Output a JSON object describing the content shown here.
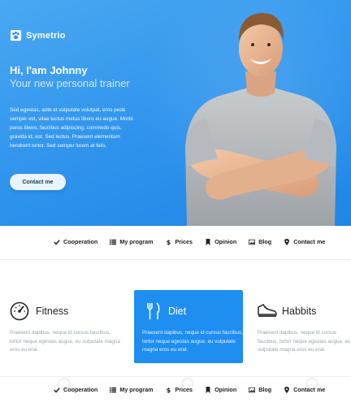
{
  "brand": {
    "name": "Symetrio"
  },
  "hero": {
    "title": "Hi, I'am Johnny",
    "subtitle": "Your new personal trainer",
    "text": "Sed egestas, ante et vulputate volutpat, eros pede semper est, vitae luctus metus libero eu augue. Morbi purus libero, faucibus adipiscing, commodo quis, gravida id, est. Sed lectus. Praesent elementum hendrerit tortor. Sed semper lorem at felis.",
    "button": "Contact me"
  },
  "nav": {
    "items": [
      {
        "label": "Cooperation",
        "icon": "check-icon"
      },
      {
        "label": "My program",
        "icon": "list-icon"
      },
      {
        "label": "Prices",
        "icon": "dollar-icon"
      },
      {
        "label": "Opinion",
        "icon": "bookmark-icon"
      },
      {
        "label": "Blog",
        "icon": "image-icon"
      },
      {
        "label": "Contact me",
        "icon": "map-marker-icon"
      }
    ]
  },
  "features": [
    {
      "title": "Fitness",
      "text": "Praesent dapibus, neque id cursus faucibus, tortor neque egestas augue, eu vulputate magna eros eu erat.",
      "icon": "speedometer-icon"
    },
    {
      "title": "Diet",
      "text": "Praesent dapibus, neque id cursus faucibus, tortor neque egestas augue, eu vulputate magna eros eu erat.",
      "icon": "fork-knife-icon"
    },
    {
      "title": "Habbits",
      "text": "Praesent dapibus, neque id cursus faucibus, tortor neque egestas augue, eu vulputate magna eros eu erat.",
      "icon": "shoe-icon"
    }
  ],
  "colors": {
    "primary": "#1e8ef0",
    "hero_light": "#4aa8f2",
    "text_muted": "#9aa3aa"
  }
}
